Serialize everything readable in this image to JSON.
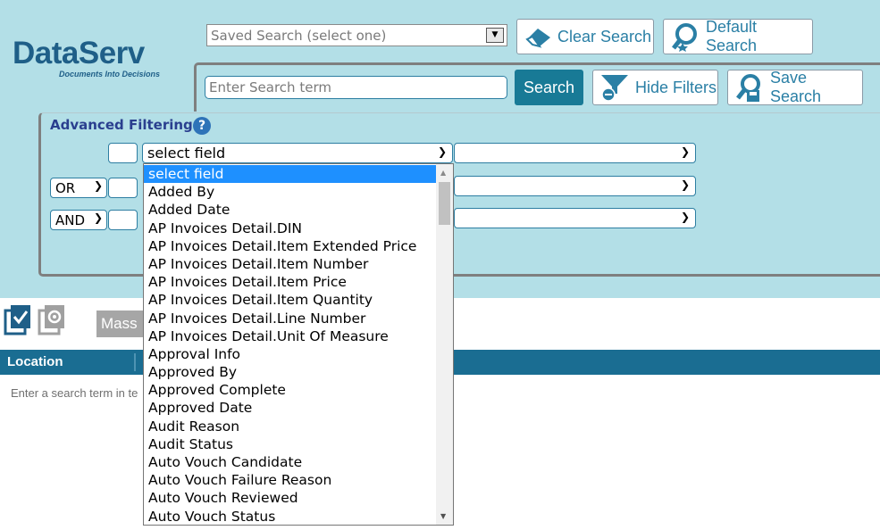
{
  "brand": {
    "name": "DataServ",
    "tagline": "Documents Into Decisions",
    "color": "#1f5f88"
  },
  "saved_search": {
    "placeholder": "Saved Search (select one)"
  },
  "buttons": {
    "clear_search": "Clear Search",
    "default_search": "Default Search",
    "search": "Search",
    "hide_filters": "Hide Filters",
    "save_search": "Save Search",
    "mass": "Mass"
  },
  "search_input": {
    "placeholder": "Enter Search term"
  },
  "advanced_filtering": {
    "title": "Advanced Filtering",
    "help_icon": "?",
    "rows": [
      {
        "operator": "",
        "field": "select field"
      },
      {
        "operator": "OR",
        "field": ""
      },
      {
        "operator": "AND",
        "field": ""
      }
    ]
  },
  "field_dropdown": {
    "selected": "select field",
    "options": [
      "select field",
      "Added By",
      "Added Date",
      "AP Invoices Detail.DIN",
      "AP Invoices Detail.Item Extended Price",
      "AP Invoices Detail.Item Number",
      "AP Invoices Detail.Item Price",
      "AP Invoices Detail.Item Quantity",
      "AP Invoices Detail.Line Number",
      "AP Invoices Detail.Unit Of Measure",
      "Approval Info",
      "Approved By",
      "Approved Complete",
      "Approved Date",
      "Audit Reason",
      "Audit Status",
      "Auto Vouch Candidate",
      "Auto Vouch Failure Reason",
      "Auto Vouch Reviewed",
      "Auto Vouch Status"
    ]
  },
  "grid": {
    "columns": [
      "Location"
    ],
    "empty_message": "Enter a search term in te"
  },
  "colors": {
    "header_bg": "#b3dfe7",
    "accent": "#187a96",
    "grid_header": "#1a6d92",
    "dropdown_highlight": "#1e90ff"
  }
}
